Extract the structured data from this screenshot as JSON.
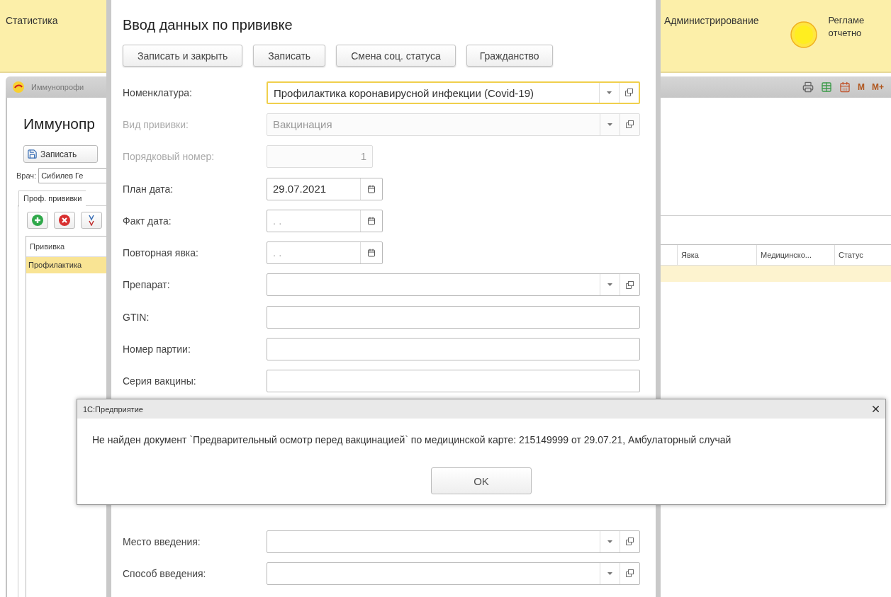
{
  "section_bar": {
    "left": "Статистика",
    "right": [
      {
        "kind": "plain",
        "lines": [
          "Администрирование"
        ]
      },
      {
        "kind": "sun",
        "lines": [
          "Регламе",
          "отчетно"
        ]
      }
    ]
  },
  "window_tab": {
    "label": "Иммунопрофи"
  },
  "tool_buttons": [
    "M",
    "M+"
  ],
  "back_form": {
    "title": "Иммунопр",
    "save_button": "Записать",
    "doctor": {
      "label": "Врач:",
      "value": "Сибилев Ге"
    },
    "tabs": [
      {
        "label": "Проф. прививки",
        "selected": true
      }
    ],
    "table": {
      "columns": [
        "Прививка",
        "Явка",
        "Медицинско...",
        "Статус"
      ],
      "rows": [
        {
          "column_1": "Профилактика",
          "selected": true
        }
      ]
    }
  },
  "dialog": {
    "title": "Ввод данных по прививке",
    "buttons": [
      "Записать и закрыть",
      "Записать",
      "Смена соц. статуса",
      "Гражданство"
    ],
    "fields_top": [
      {
        "label": "Номенклатура:",
        "kind": "select",
        "value": "Профилактика коронавирусной инфекции (Covid-19)",
        "disabled": false,
        "focused": true
      },
      {
        "label": "Вид прививки:",
        "kind": "select",
        "value": "Вакцинация",
        "disabled": true,
        "focused": false
      },
      {
        "label": "Порядковый номер:",
        "kind": "number",
        "value": "1",
        "disabled": true,
        "focused": false
      },
      {
        "label": "План дата:",
        "kind": "date",
        "value": "29.07.2021",
        "disabled": false,
        "focused": false
      },
      {
        "label": "Факт дата:",
        "kind": "date",
        "placeholder": ". .",
        "disabled": false,
        "focused": false
      },
      {
        "label": "Повторная явка:",
        "kind": "date",
        "placeholder": ". .",
        "disabled": false,
        "focused": false
      },
      {
        "label": "Препарат:",
        "kind": "select",
        "disabled": false,
        "focused": false
      },
      {
        "label": "GTIN:",
        "kind": "text",
        "disabled": false,
        "focused": false
      },
      {
        "label": "Номер партии:",
        "kind": "text",
        "disabled": false,
        "focused": false
      },
      {
        "label": "Серия вакцины:",
        "kind": "text",
        "disabled": false,
        "focused": false
      }
    ],
    "fields_bottom": [
      {
        "label": "Место введения:",
        "kind": "select",
        "disabled": false,
        "focused": false
      },
      {
        "label": "Способ введения:",
        "kind": "select",
        "disabled": false,
        "focused": false
      }
    ]
  },
  "message_box": {
    "title": "1С:Предприятие",
    "text": "Не найден документ `Предварительный осмотр перед вакцинацией` по медицинской карте: 215149999 от 29.07.21, Амбулаторный случай",
    "button": "OK"
  }
}
